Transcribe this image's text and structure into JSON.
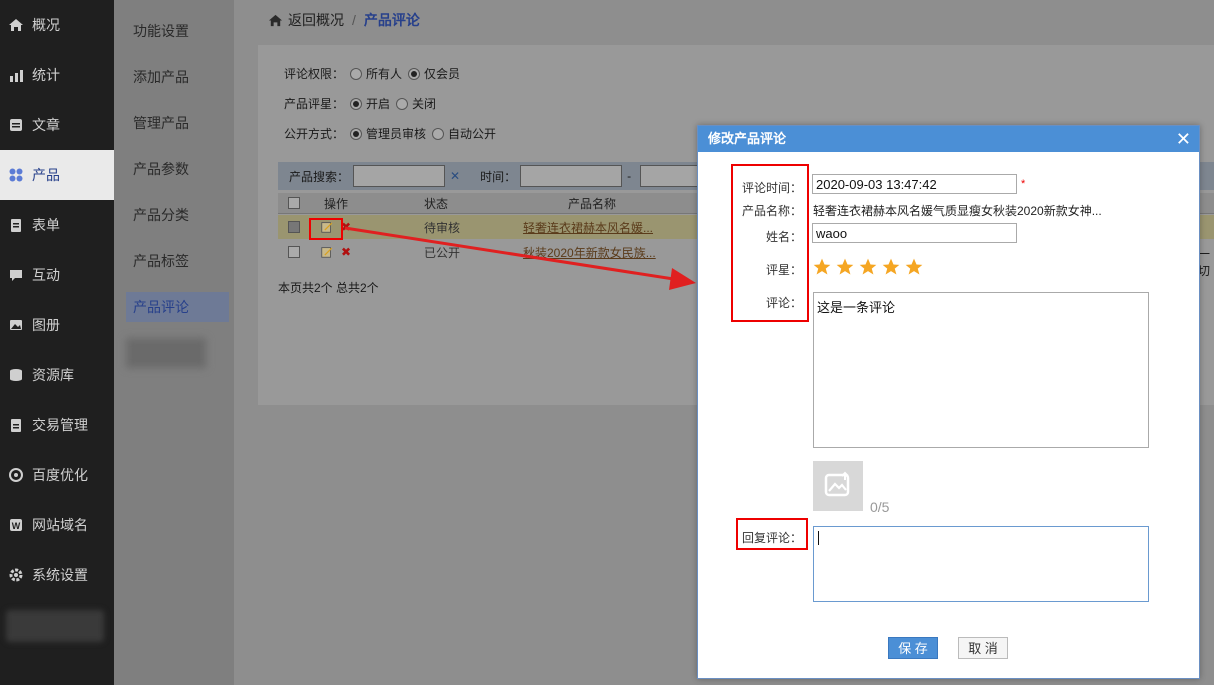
{
  "nav": {
    "items": [
      {
        "label": "概况",
        "icon": "home-icon"
      },
      {
        "label": "统计",
        "icon": "chart-icon"
      },
      {
        "label": "文章",
        "icon": "article-icon"
      },
      {
        "label": "产品",
        "icon": "grid-icon"
      },
      {
        "label": "表单",
        "icon": "form-icon"
      },
      {
        "label": "互动",
        "icon": "chat-icon"
      },
      {
        "label": "图册",
        "icon": "image-icon"
      },
      {
        "label": "资源库",
        "icon": "database-icon"
      },
      {
        "label": "交易管理",
        "icon": "clipboard-icon"
      },
      {
        "label": "百度优化",
        "icon": "target-icon"
      },
      {
        "label": "网站域名",
        "icon": "w-icon"
      },
      {
        "label": "系统设置",
        "icon": "gear-icon"
      }
    ],
    "active_index": 3
  },
  "subnav": {
    "items": [
      "功能设置",
      "添加产品",
      "管理产品",
      "产品参数",
      "产品分类",
      "产品标签",
      "产品评论"
    ],
    "active_index": 6
  },
  "breadcrumb": {
    "back": "返回概况",
    "sep": "/",
    "current": "产品评论"
  },
  "settings": {
    "permission": {
      "label": "评论权限：",
      "options": [
        "所有人",
        "仅会员"
      ],
      "selected": 1
    },
    "rating": {
      "label": "产品评星：",
      "options": [
        "开启",
        "关闭"
      ],
      "selected": 0
    },
    "publish": {
      "label": "公开方式：",
      "options": [
        "管理员审核",
        "自动公开"
      ],
      "selected": 0
    }
  },
  "search": {
    "label": "产品搜索：",
    "clear": "✕",
    "time_label": "时间：",
    "dash": "-"
  },
  "table": {
    "columns": [
      "操作",
      "状态",
      "产品名称"
    ],
    "rows": [
      {
        "status": "待审核",
        "name": "轻奢连衣裙赫本风名媛...",
        "checked": true
      },
      {
        "status": "已公开",
        "name": "秋装2020年新款女民族...",
        "checked": false
      }
    ],
    "overflow_text": "一切"
  },
  "pager": {
    "text": "本页共2个 总共2个"
  },
  "modal": {
    "title": "修改产品评论",
    "close": "✕",
    "time_label": "评论时间：",
    "time_value": "2020-09-03 13:47:42",
    "required": "*",
    "product_label": "产品名称：",
    "product_value": "轻奢连衣裙赫本风名媛气质显瘦女秋装2020新款女神...",
    "name_label": "姓名：",
    "name_value": "waoo",
    "rating_label": "评星：",
    "rating_value": 5,
    "comment_label": "评论：",
    "comment_value": "这是一条评论",
    "image_count": "0/5",
    "reply_label": "回复评论：",
    "reply_value": "",
    "save": "保 存",
    "cancel": "取 消"
  },
  "colors": {
    "accent": "#4b8fd6",
    "highlight": "#e00000",
    "star": "#f5a623"
  }
}
